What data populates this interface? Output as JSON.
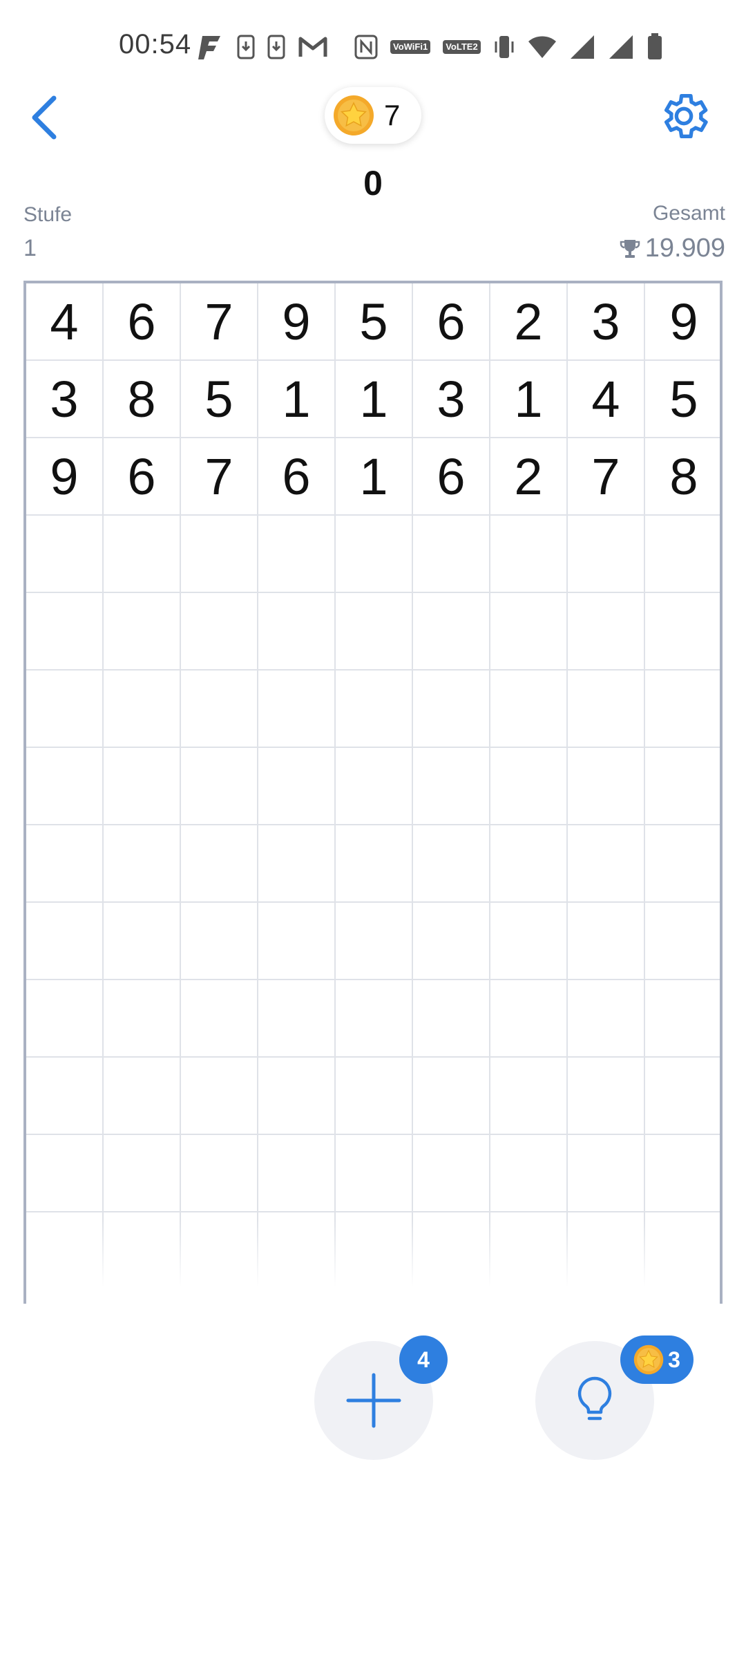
{
  "status_bar": {
    "time": "00:54",
    "icons": [
      "f-app-icon",
      "download-icon",
      "download-icon",
      "gmail-icon",
      "nfc-icon",
      "vowifi-icon",
      "volte-icon",
      "vibrate-icon",
      "wifi-icon",
      "signal-icon",
      "signal-icon",
      "battery-icon"
    ],
    "vowifi_label": "VoWiFi1",
    "volte_label": "VoLTE2"
  },
  "header": {
    "coins": "7",
    "score": "0",
    "level_label": "Stufe",
    "level_value": "1",
    "total_label": "Gesamt",
    "total_value": "19.909"
  },
  "board": {
    "rows": [
      [
        "4",
        "6",
        "7",
        "9",
        "5",
        "6",
        "2",
        "3",
        "9"
      ],
      [
        "3",
        "8",
        "5",
        "1",
        "1",
        "3",
        "1",
        "4",
        "5"
      ],
      [
        "9",
        "6",
        "7",
        "6",
        "1",
        "6",
        "2",
        "7",
        "8"
      ]
    ],
    "empty_rows": 10,
    "columns": 9
  },
  "actions": {
    "add_badge": "4",
    "hint_badge": "3"
  },
  "colors": {
    "accent": "#2e7fe0",
    "muted_text": "#7b8494",
    "grid_line": "#dfe2e8",
    "board_border": "#a9b1c2"
  }
}
